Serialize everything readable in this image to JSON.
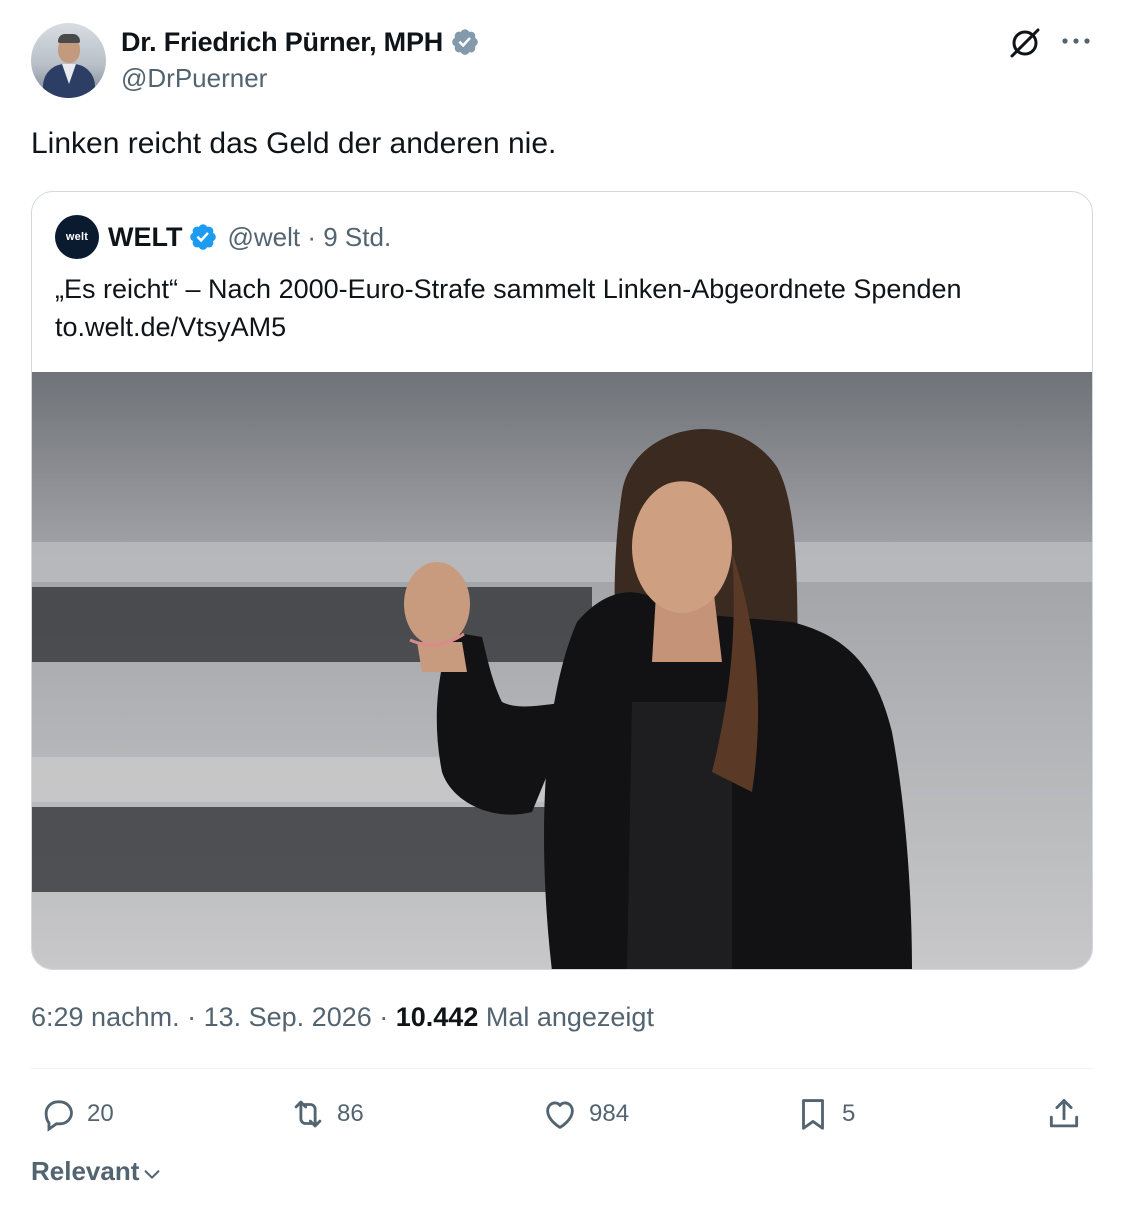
{
  "author": {
    "display_name": "Dr. Friedrich Pürner, MPH",
    "handle": "@DrPuerner",
    "verified_badge_color": "#829aab"
  },
  "post": {
    "text": "Linken reicht das Geld der anderen nie."
  },
  "quoted_post": {
    "logo_text": "welt",
    "name": "WELT",
    "verified_badge_color": "#1d9bf0",
    "handle": "@welt",
    "separator": " · ",
    "time": "9 Std.",
    "text_line1": "„Es reicht“ – Nach 2000-Euro-Strafe sammelt Linken-Abgeordnete Spenden",
    "text_line2": "to.welt.de/VtsyAM5"
  },
  "meta": {
    "time": "6:29 nachm.",
    "separator": " · ",
    "date": "13. Sep. 2026",
    "views_count": "10.442",
    "views_label": " Mal angezeigt"
  },
  "actions": {
    "reply_count": "20",
    "repost_count": "86",
    "like_count": "984",
    "bookmark_count": "5"
  },
  "sort": {
    "label": "Relevant"
  },
  "icons": {
    "grok": "grok-icon",
    "more": "more-icon",
    "reply": "reply-icon",
    "repost": "repost-icon",
    "like": "heart-icon",
    "bookmark": "bookmark-icon",
    "share": "share-icon",
    "chevron": "chevron-down-icon"
  },
  "colors": {
    "text_primary": "#0f1419",
    "text_secondary": "#536471",
    "border": "#cfd9de"
  }
}
